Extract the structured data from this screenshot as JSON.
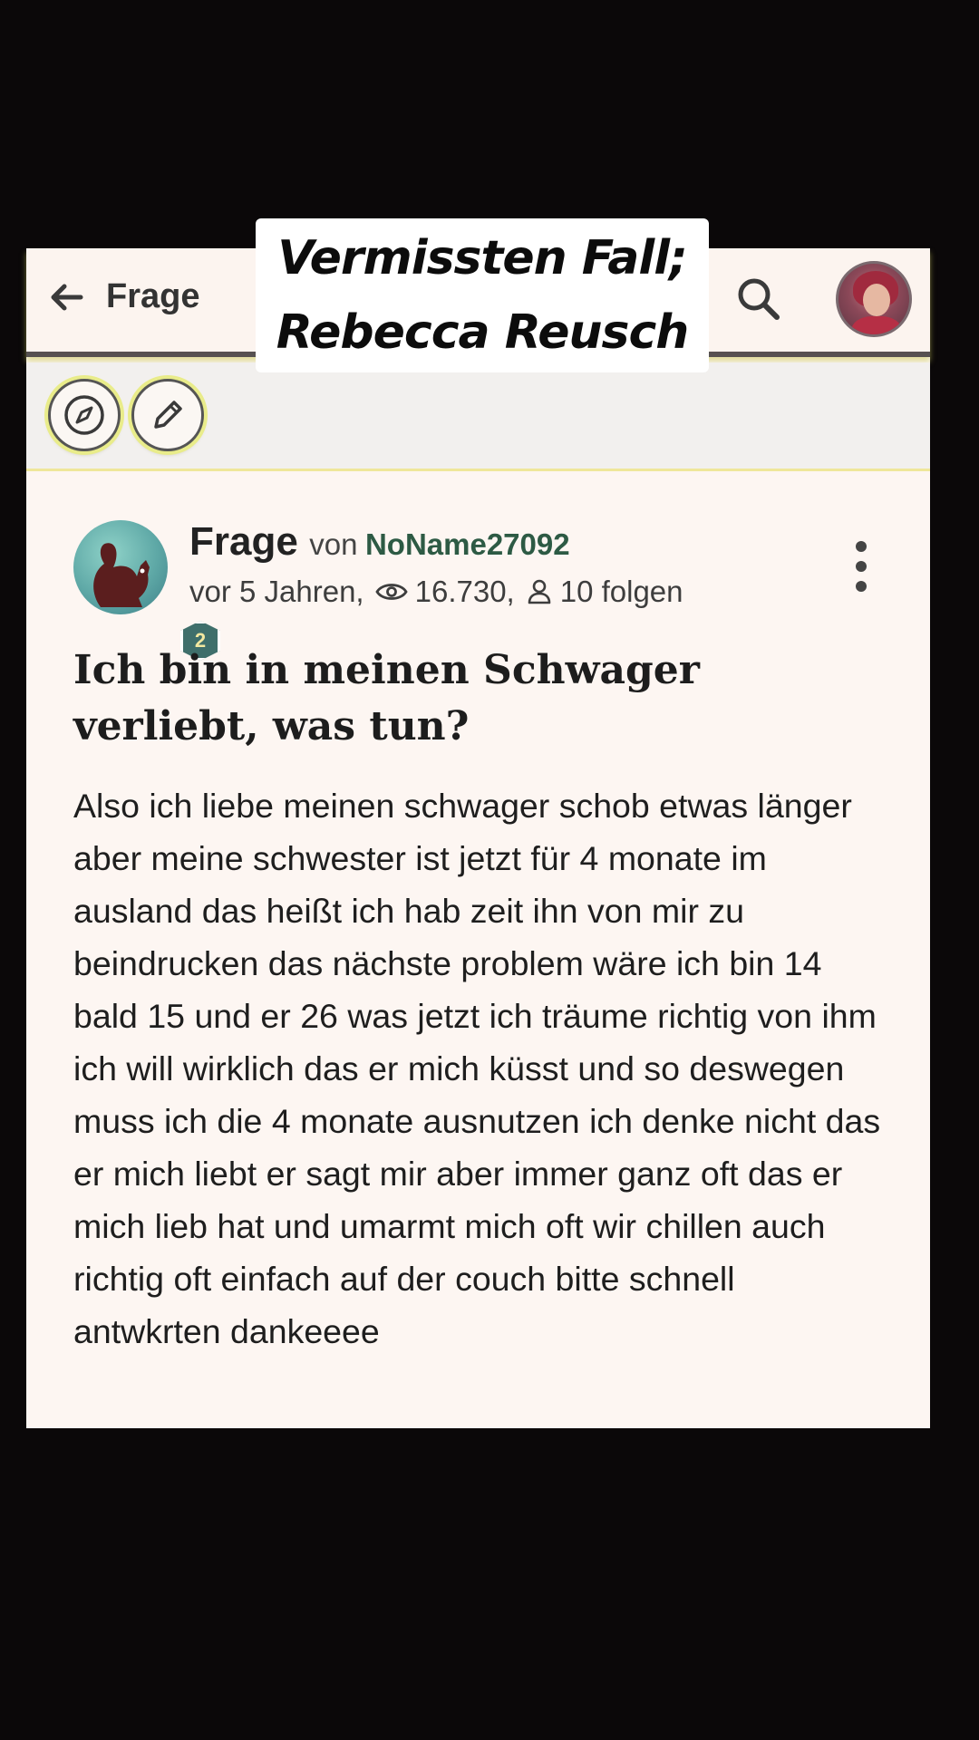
{
  "overlay_caption": {
    "line1": "Vermissten Fall;",
    "line2": "Rebecca Reusch"
  },
  "appbar": {
    "title": "Frage",
    "icons": [
      "back-arrow-icon",
      "search-icon",
      "user-avatar"
    ]
  },
  "toolbar": {
    "icons": [
      "compass-icon",
      "pencil-icon"
    ]
  },
  "post": {
    "type_label": "Frage",
    "von": "von",
    "author": "NoName27092",
    "author_level": "2",
    "age": "vor 5 Jahren,",
    "views": "16.730,",
    "followers": "10 folgen",
    "title": "Ich bin in meinen Schwager verliebt, was tun?",
    "body": "Also ich liebe meinen schwager schob etwas länger aber meine schwester ist jetzt für 4 monate im ausland das heißt ich hab zeit ihn von mir zu beindrucken das nächste problem wäre ich bin 14 bald 15 und er 26 was jetzt ich träume richtig von ihm ich will wirklich das er mich küsst und so deswegen muss ich die 4 monate ausnutzen ich denke nicht das er mich liebt er sagt mir aber immer ganz oft das er mich lieb hat und umarmt mich oft wir chillen auch richtig oft einfach auf der couch bitte schnell antwkrten dankeeee"
  },
  "colors": {
    "background": "#0b0809",
    "card": "#fdf6f2",
    "author": "#2d5a44",
    "highlight": "#e9ec8a"
  }
}
